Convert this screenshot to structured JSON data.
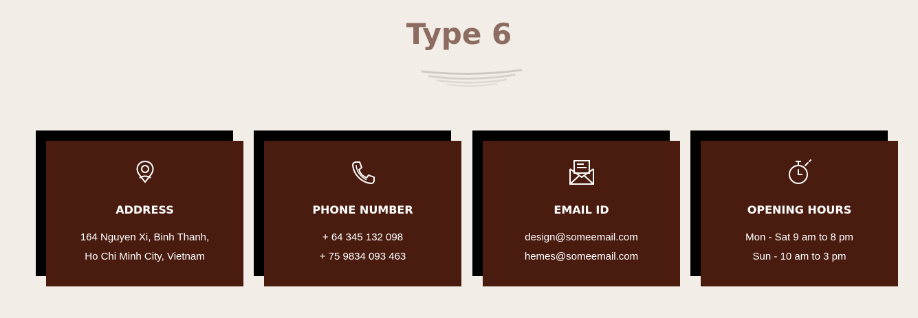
{
  "section": {
    "title": "Type 6"
  },
  "colors": {
    "background": "#f2ede6",
    "title": "#8c6b60",
    "card": "#4a1c10",
    "card_shadow": "#000000",
    "card_text": "#ffffff"
  },
  "cards": [
    {
      "icon": "location-pin-icon",
      "title": "ADDRESS",
      "line1": "164 Nguyen Xi, Binh Thanh,",
      "line2": "Ho Chi Minh City, Vietnam"
    },
    {
      "icon": "phone-icon",
      "title": "PHONE NUMBER",
      "line1": "+ 64 345 132 098",
      "line2": "+ 75 9834 093 463"
    },
    {
      "icon": "envelope-icon",
      "title": "EMAIL ID",
      "line1": "design@someemail.com",
      "line2": "hemes@someemail.com"
    },
    {
      "icon": "stopwatch-icon",
      "title": "OPENING HOURS",
      "line1": "Mon - Sat 9 am to 8 pm",
      "line2": "Sun - 10 am to 3 pm"
    }
  ]
}
